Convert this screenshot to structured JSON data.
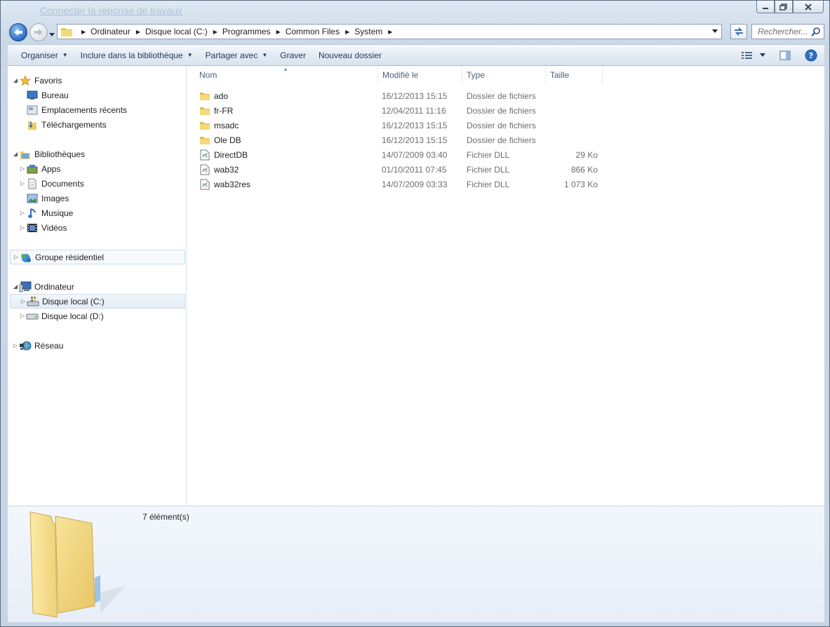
{
  "window": {
    "ghost_title": "Connecter la réponse de travaux",
    "caption": {
      "minimize": "minimize",
      "maximize": "maximize",
      "close": "close"
    }
  },
  "address": {
    "breadcrumbs": [
      "Ordinateur",
      "Disque local (C:)",
      "Programmes",
      "Common Files",
      "System"
    ],
    "search_placeholder": "Rechercher..."
  },
  "toolbar": {
    "organize": "Organiser",
    "include_library": "Inclure dans la bibliothèque",
    "share_with": "Partager avec",
    "burn": "Graver",
    "new_folder": "Nouveau dossier"
  },
  "nav": {
    "favorites": {
      "label": "Favoris",
      "items": [
        "Bureau",
        "Emplacements récents",
        "Téléchargements"
      ]
    },
    "libraries": {
      "label": "Bibliothèques",
      "items": [
        "Apps",
        "Documents",
        "Images",
        "Musique",
        "Vidéos"
      ]
    },
    "homegroup": {
      "label": "Groupe résidentiel"
    },
    "computer": {
      "label": "Ordinateur",
      "items": [
        "Disque local (C:)",
        "Disque local (D:)"
      ]
    },
    "network": {
      "label": "Réseau"
    }
  },
  "columns": {
    "name": "Nom",
    "modified": "Modifié le",
    "type": "Type",
    "size": "Taille"
  },
  "files": [
    {
      "name": "ado",
      "modified": "16/12/2013 15:15",
      "type": "Dossier de fichiers",
      "size": "",
      "kind": "folder"
    },
    {
      "name": "fr-FR",
      "modified": "12/04/2011 11:16",
      "type": "Dossier de fichiers",
      "size": "",
      "kind": "folder"
    },
    {
      "name": "msadc",
      "modified": "16/12/2013 15:15",
      "type": "Dossier de fichiers",
      "size": "",
      "kind": "folder"
    },
    {
      "name": "Ole DB",
      "modified": "16/12/2013 15:15",
      "type": "Dossier de fichiers",
      "size": "",
      "kind": "folder"
    },
    {
      "name": "DirectDB",
      "modified": "14/07/2009 03:40",
      "type": "Fichier DLL",
      "size": "29 Ko",
      "kind": "dll"
    },
    {
      "name": "wab32",
      "modified": "01/10/2011 07:45",
      "type": "Fichier DLL",
      "size": "866 Ko",
      "kind": "dll"
    },
    {
      "name": "wab32res",
      "modified": "14/07/2009 03:33",
      "type": "Fichier DLL",
      "size": "1 073 Ko",
      "kind": "dll"
    }
  ],
  "details": {
    "item_count": "7 élément(s)"
  },
  "colors": {
    "accent": "#1e395b",
    "folder": "#f3d66e",
    "selection": "#e5edf6"
  }
}
